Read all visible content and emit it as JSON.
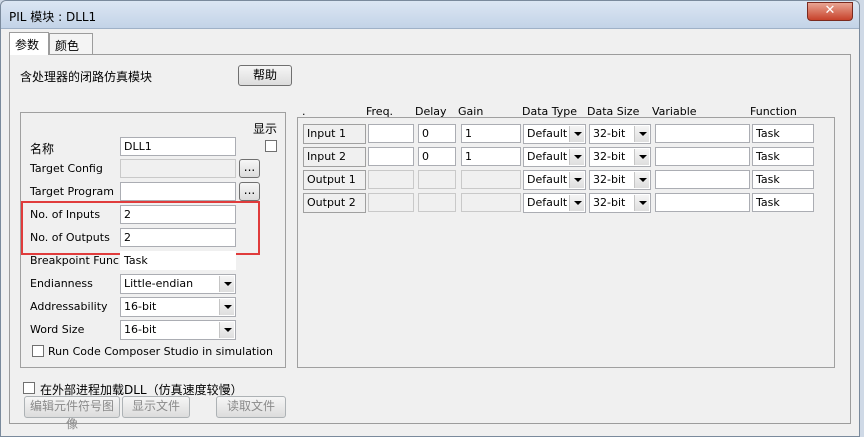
{
  "window": {
    "title": "PIL 模块 : DLL1",
    "close_label": "✕"
  },
  "tabs": [
    {
      "label": "参数"
    },
    {
      "label": "颜色"
    }
  ],
  "description": "含处理器的闭路仿真模块",
  "help_button": "帮助",
  "left": {
    "display_label": "显示",
    "name_label": "名称",
    "name_value": "DLL1",
    "target_config_label": "Target Config",
    "target_program_label": "Target Program",
    "browse_label": "...",
    "inputs_label": "No. of Inputs",
    "inputs_value": "2",
    "outputs_label": "No. of Outputs",
    "outputs_value": "2",
    "breakpoint_label": "Breakpoint Func.",
    "breakpoint_value": "Task",
    "endianness_label": "Endianness",
    "endianness_value": "Little-endian",
    "addressability_label": "Addressability",
    "addressability_value": "16-bit",
    "word_size_label": "Word Size",
    "word_size_value": "16-bit",
    "run_ccs_label": "Run Code Composer Studio in simulation"
  },
  "grid": {
    "headers": {
      "dot": ".",
      "freq": "Freq.",
      "delay": "Delay",
      "gain": "Gain",
      "data_type": "Data Type",
      "data_size": "Data Size",
      "variable": "Variable",
      "function": "Function"
    },
    "rows": [
      {
        "label": "Input 1",
        "freq": "",
        "delay": "0",
        "gain": "1",
        "data_type": "Default",
        "data_size": "32-bit",
        "variable": "",
        "function": "Task"
      },
      {
        "label": "Input 2",
        "freq": "",
        "delay": "0",
        "gain": "1",
        "data_type": "Default",
        "data_size": "32-bit",
        "variable": "",
        "function": "Task"
      },
      {
        "label": "Output 1",
        "freq": "",
        "delay": "",
        "gain": "",
        "data_type": "Default",
        "data_size": "32-bit",
        "variable": "",
        "function": "Task"
      },
      {
        "label": "Output 2",
        "freq": "",
        "delay": "",
        "gain": "",
        "data_type": "Default",
        "data_size": "32-bit",
        "variable": "",
        "function": "Task"
      }
    ]
  },
  "bottom": {
    "external_process_label": "在外部进程加载DLL（仿真速度较慢）",
    "edit_symbol_button": "编辑元件符号图像",
    "show_file_button": "显示文件",
    "read_file_button": "读取文件"
  },
  "colors": {
    "highlight": "#e03c3c",
    "close_button": "#c7422b"
  }
}
